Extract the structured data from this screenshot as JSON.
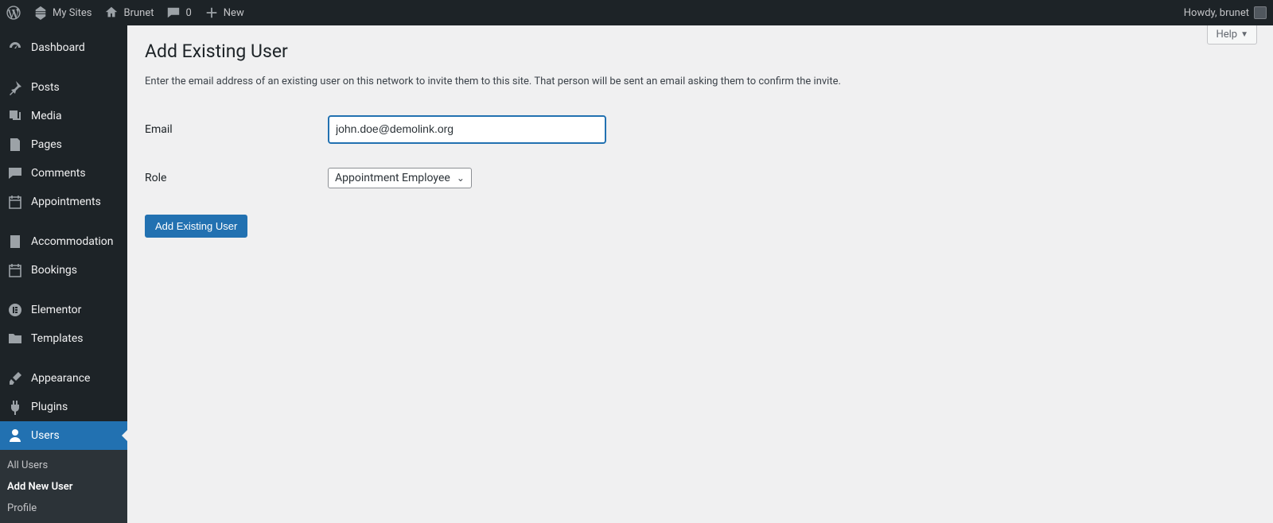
{
  "adminbar": {
    "my_sites": "My Sites",
    "site_name": "Brunet",
    "comments_count": "0",
    "new_label": "New",
    "howdy": "Howdy, brunet"
  },
  "sidebar": {
    "items": [
      {
        "label": "Dashboard"
      },
      {
        "label": "Posts"
      },
      {
        "label": "Media"
      },
      {
        "label": "Pages"
      },
      {
        "label": "Comments"
      },
      {
        "label": "Appointments"
      },
      {
        "label": "Accommodation"
      },
      {
        "label": "Bookings"
      },
      {
        "label": "Elementor"
      },
      {
        "label": "Templates"
      },
      {
        "label": "Appearance"
      },
      {
        "label": "Plugins"
      },
      {
        "label": "Users"
      }
    ],
    "submenu": [
      {
        "label": "All Users"
      },
      {
        "label": "Add New User"
      },
      {
        "label": "Profile"
      }
    ]
  },
  "page": {
    "help_label": "Help",
    "title": "Add Existing User",
    "description": "Enter the email address of an existing user on this network to invite them to this site. That person will be sent an email asking them to confirm the invite.",
    "email_label": "Email",
    "email_value": "john.doe@demolink.org",
    "role_label": "Role",
    "role_value": "Appointment Employee",
    "submit_label": "Add Existing User"
  }
}
